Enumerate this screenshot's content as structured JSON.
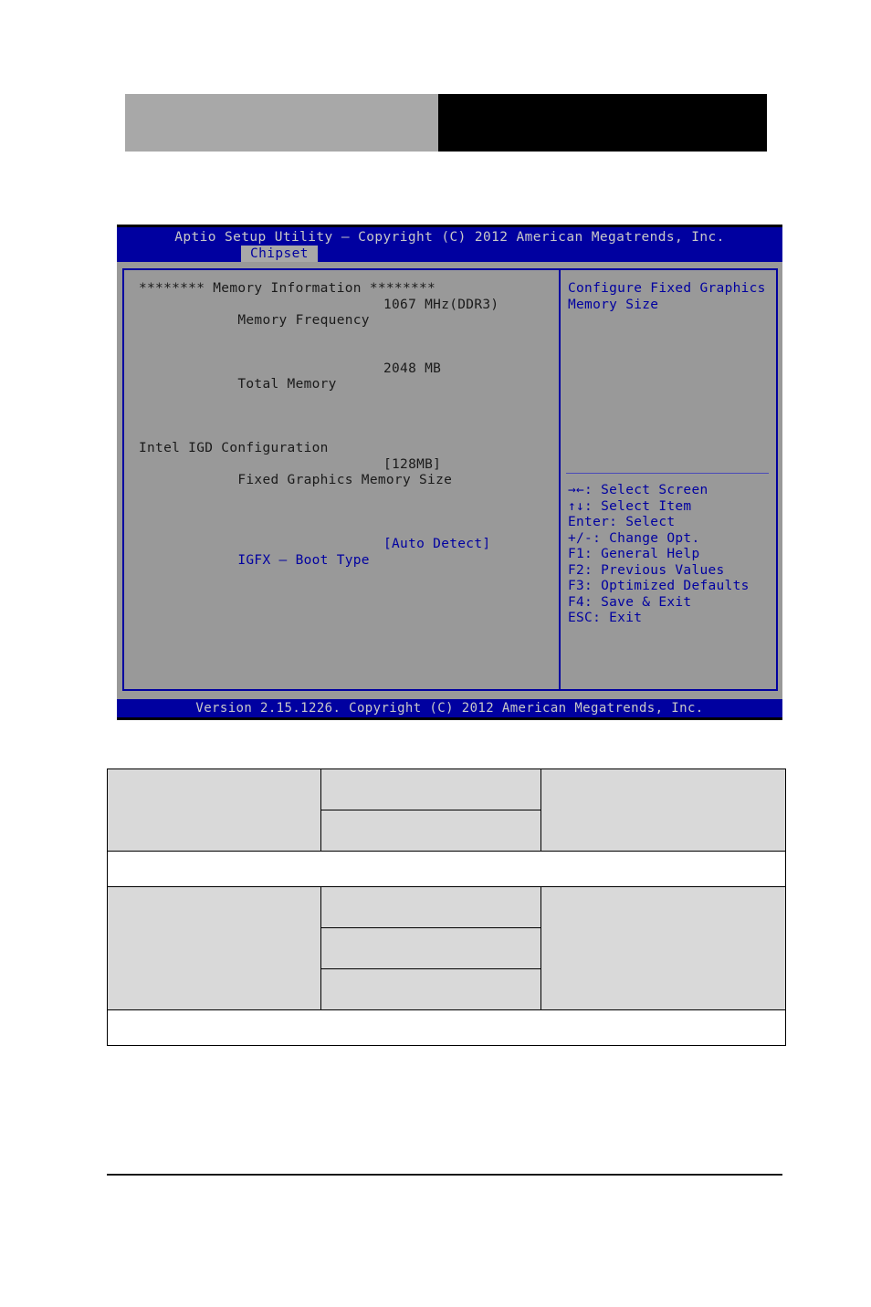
{
  "page": {
    "header_band": {
      "gray_block_label": "",
      "black_block_label": "",
      "gray_color": "#a8a8a8",
      "black_color": "#000000"
    }
  },
  "bios": {
    "colors": {
      "title_blue": "#0000a0",
      "panel_gray": "#999999",
      "tab_gray": "#a8a8a8",
      "text_light": "#c8c8c8",
      "text_dark": "#1a1a1a",
      "accent_blue": "#0000a0"
    },
    "title": "Aptio Setup Utility – Copyright (C) 2012 American Megatrends, Inc.",
    "tab": {
      "label": "Chipset",
      "selected": true
    },
    "left_pane": {
      "section_header": "******** Memory Information ********",
      "rows": [
        {
          "label": "Memory Frequency",
          "value": "1067 MHz(DDR3)",
          "highlighted": false
        },
        {
          "label": "Total Memory",
          "value": "2048 MB",
          "highlighted": false
        }
      ],
      "group_header": "Intel IGD Configuration",
      "settings": [
        {
          "label": "Fixed Graphics Memory Size",
          "value": "[128MB]",
          "highlighted": false
        },
        {
          "label": "IGFX – Boot Type",
          "value": "[Auto Detect]",
          "highlighted": true
        }
      ]
    },
    "right_pane": {
      "help_text_lines": [
        "Configure Fixed Graphics",
        "Memory Size"
      ],
      "key_help": [
        "→←: Select Screen",
        "↑↓: Select Item",
        "Enter: Select",
        "+/-: Change Opt.",
        "F1: General Help",
        "F2: Previous Values",
        "F3: Optimized Defaults",
        "F4: Save & Exit",
        "ESC: Exit"
      ]
    },
    "version_footer": "Version 2.15.1226. Copyright (C) 2012 American Megatrends, Inc."
  },
  "spec_table": {
    "groups": [
      {
        "feature": "",
        "options": [
          "",
          ""
        ],
        "description": ""
      },
      {
        "note": ""
      },
      {
        "feature": "",
        "options": [
          "",
          "",
          ""
        ],
        "description": ""
      },
      {
        "note": ""
      }
    ]
  }
}
